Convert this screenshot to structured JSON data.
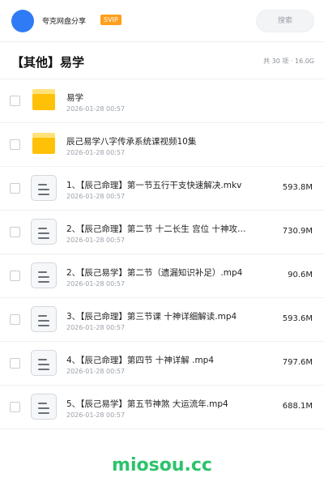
{
  "header": {
    "app_name": "夸克网盘分享",
    "badge": "SVIP",
    "search_label": "搜索"
  },
  "folder": {
    "title": "【其他】易学",
    "summary": "共 30 项 · 16.0G"
  },
  "files": [
    {
      "type": "folder",
      "name": "易学",
      "date": "2026-01-28 00:57",
      "size": ""
    },
    {
      "type": "folder",
      "name": "辰己易学八字传承系统课视频10集",
      "date": "2026-01-28 00:57",
      "size": ""
    },
    {
      "type": "file",
      "name": "1、【辰己命理】第一节五行干支快速解决.mkv",
      "date": "2026-01-28 00:57",
      "size": "593.8M"
    },
    {
      "type": "file",
      "name": "2、【辰己命理】第二节  十二长生  宫位 十神攻…",
      "date": "2026-01-28 00:57",
      "size": "730.9M"
    },
    {
      "type": "file",
      "name": "2、【辰己易学】第二节（遗漏知识补足）.mp4",
      "date": "2026-01-28 00:57",
      "size": "90.6M"
    },
    {
      "type": "file",
      "name": "3、【辰己命理】第三节课 十神详细解读.mp4",
      "date": "2026-01-28 00:57",
      "size": "593.6M"
    },
    {
      "type": "file",
      "name": "4、【辰己命理】第四节  十神详解 .mp4",
      "date": "2026-01-28 00:57",
      "size": "797.6M"
    },
    {
      "type": "file",
      "name": "5、【辰己易学】第五节神煞 大运流年.mp4",
      "date": "2026-01-28 00:57",
      "size": "688.1M"
    }
  ],
  "watermark": "miosou.cc",
  "colors": {
    "avatar": "#2f7bf5",
    "svip_badge": "#ff9f1c",
    "folder": "#ffc107",
    "watermark": "#2cc36b"
  }
}
